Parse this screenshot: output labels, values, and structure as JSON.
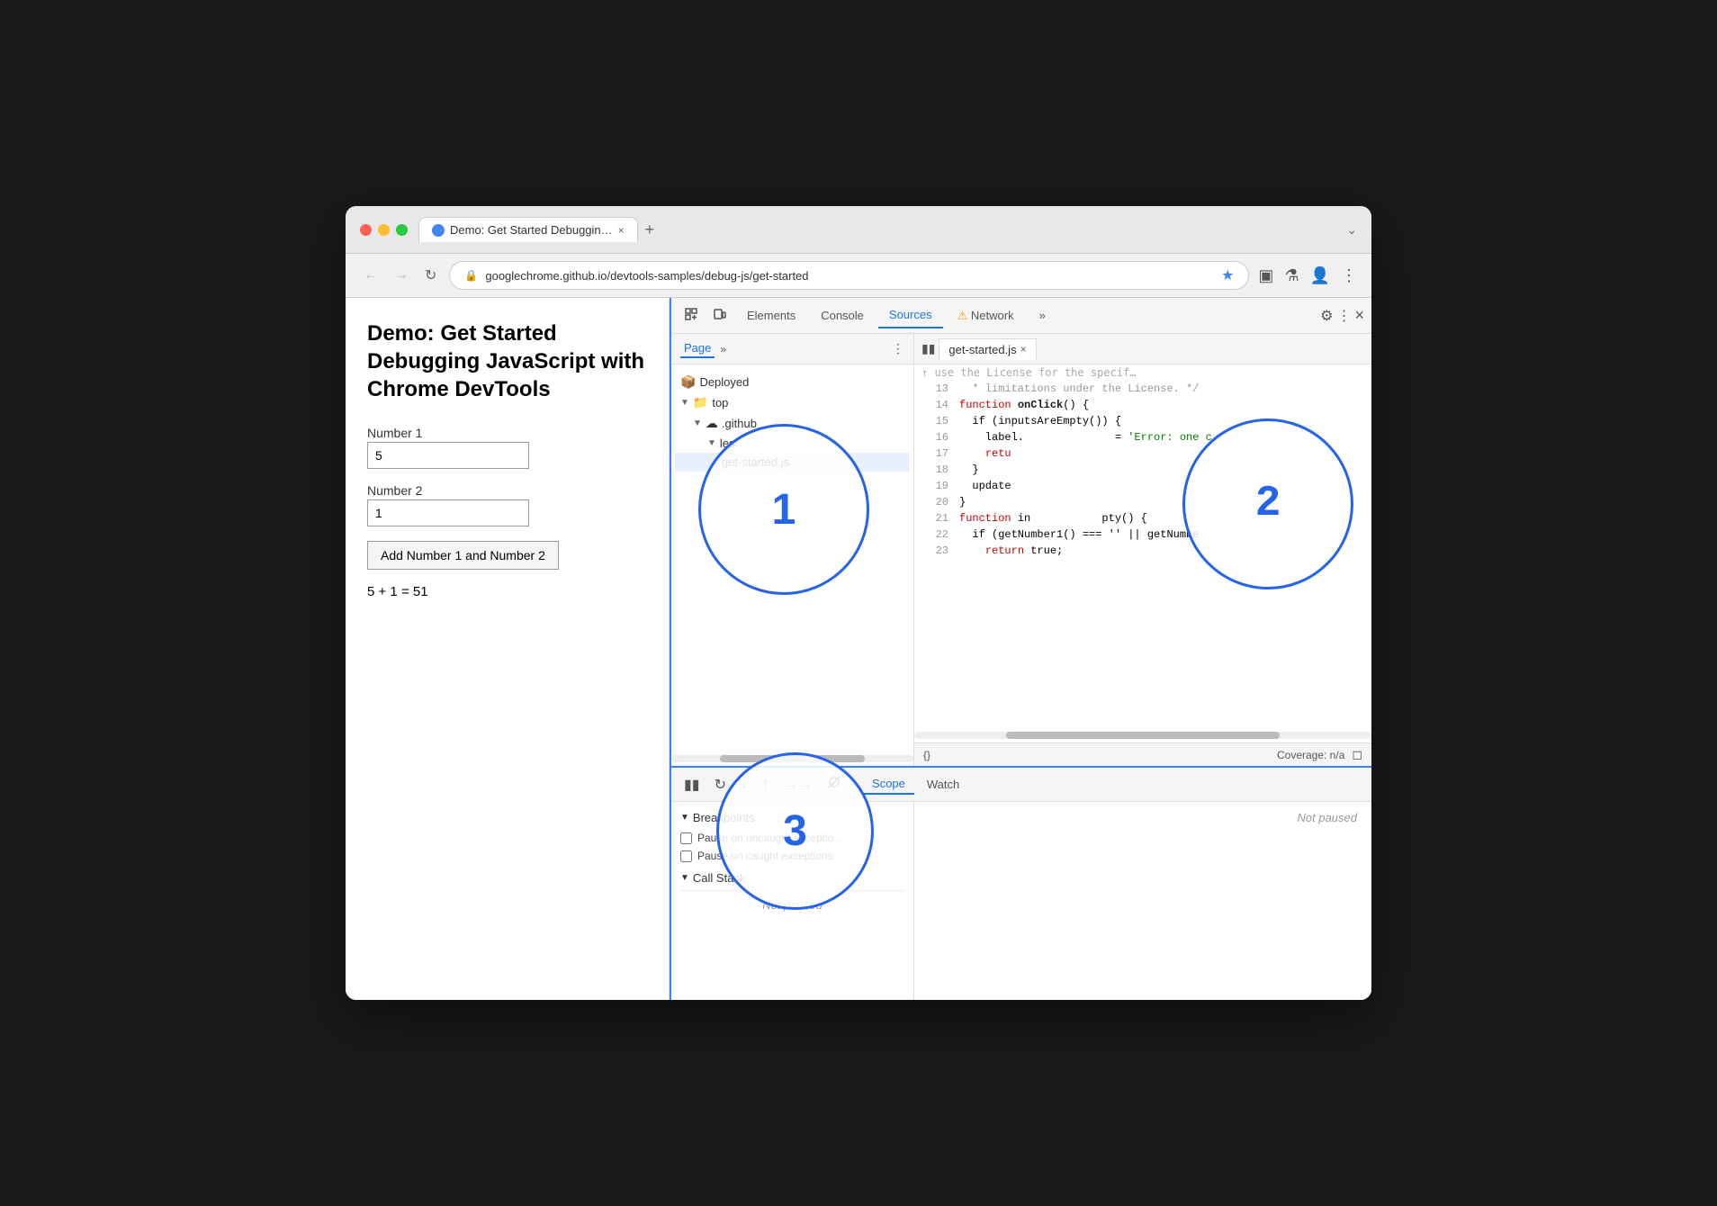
{
  "browser": {
    "tab_title": "Demo: Get Started Debuggin…",
    "tab_close": "×",
    "tab_new": "+",
    "address": "googlechrome.github.io/devtools-samples/debug-js/get-started",
    "chevron": "⌄"
  },
  "page": {
    "title": "Demo: Get Started Debugging JavaScript with Chrome DevTools",
    "number1_label": "Number 1",
    "number1_value": "5",
    "number2_label": "Number 2",
    "number2_value": "1",
    "button_label": "Add Number 1 and Number 2",
    "result": "5 + 1 = 51"
  },
  "devtools": {
    "tabs": {
      "elements": "Elements",
      "console": "Console",
      "sources": "Sources",
      "network": "Network",
      "more": "»",
      "settings_icon": "⚙",
      "more_icon": "⋮",
      "close_icon": "×"
    },
    "sources_panel": {
      "page_tab": "Page",
      "page_tab_more": "»",
      "file_tree": [
        {
          "label": "Deployed",
          "icon": "📦",
          "indent": 0,
          "arrow": ""
        },
        {
          "label": "top",
          "icon": "📁",
          "indent": 0,
          "arrow": "▼"
        },
        {
          "label": ".github",
          "icon": "☁",
          "indent": 1,
          "arrow": "▼"
        },
        {
          "label": "les/",
          "icon": "",
          "indent": 2,
          "arrow": "▼"
        },
        {
          "label": "get-started.js",
          "icon": "",
          "indent": 3,
          "arrow": ""
        }
      ],
      "file_tab": "get-started.js",
      "file_close": "×",
      "code_lines": [
        {
          "num": "13",
          "code": "   * limitations under the License. */",
          "style": "comment"
        },
        {
          "num": "14",
          "code": "function onClick() {",
          "style": "kw-fn"
        },
        {
          "num": "15",
          "code": "  if (inputsAreEmpty()) {",
          "style": "normal"
        },
        {
          "num": "16",
          "code": "    label.              = 'Error: one c",
          "style": "str"
        },
        {
          "num": "17",
          "code": "    retu",
          "style": "normal"
        },
        {
          "num": "18",
          "code": "  }",
          "style": "normal"
        },
        {
          "num": "19",
          "code": "  update",
          "style": "normal"
        },
        {
          "num": "20",
          "code": "}",
          "style": "normal"
        },
        {
          "num": "21",
          "code": "function in           pty() {",
          "style": "kw-fn"
        },
        {
          "num": "22",
          "code": "  if (getNumber1() === '' || getNumbe",
          "style": "normal"
        },
        {
          "num": "23",
          "code": "    return true;",
          "style": "normal"
        }
      ],
      "coverage": "Coverage: n/a"
    },
    "debug_panel": {
      "scope_tab": "Scope",
      "watch_tab": "Watch",
      "breakpoints_label": "Breakpoints",
      "pause_uncaught": "Pause on uncaught exceptio…",
      "pause_caught": "Pause on caught exceptions",
      "callstack_label": "Call Stack",
      "not_paused_left": "Not paused",
      "not_paused_right": "Not paused"
    }
  },
  "annotations": {
    "circle1": "1",
    "circle2": "2",
    "circle3": "3"
  }
}
